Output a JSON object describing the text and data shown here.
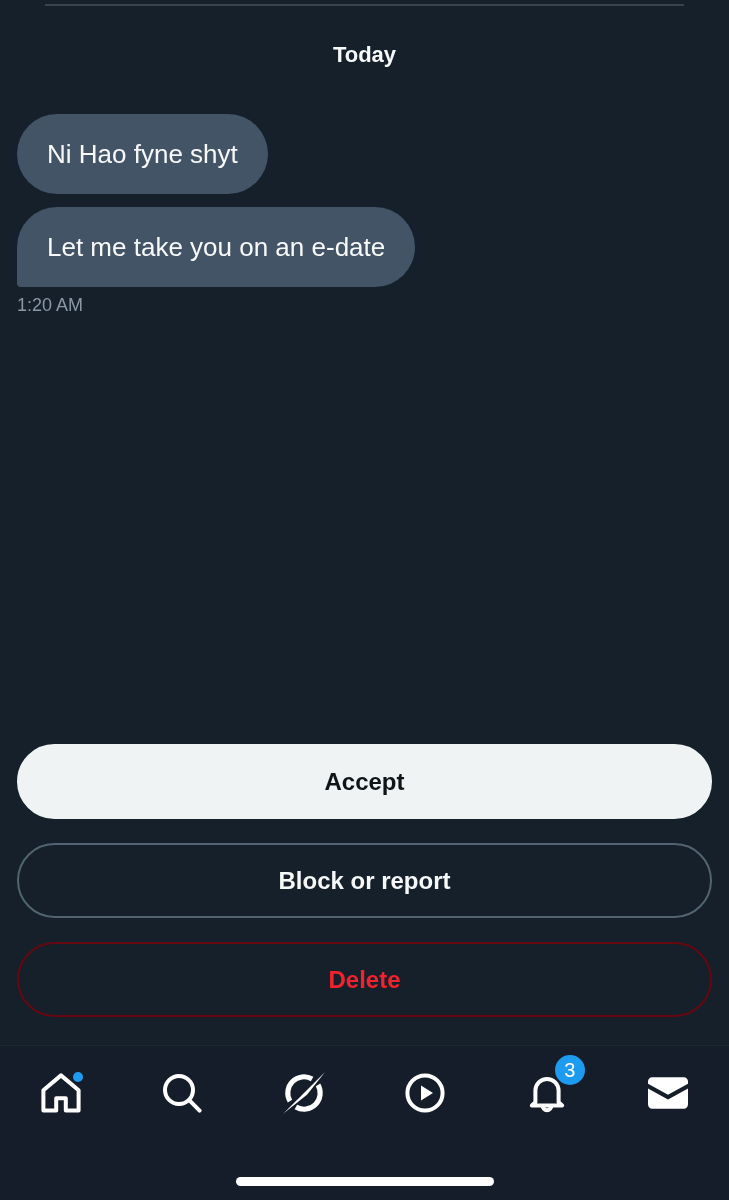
{
  "date_header": "Today",
  "messages": [
    {
      "text": "Ni Hao fyne shyt",
      "tail": false
    },
    {
      "text": "Let me take you on an e-date",
      "tail": true
    }
  ],
  "timestamp": "1:20 AM",
  "actions": [
    {
      "label": "Accept",
      "kind": "primary"
    },
    {
      "label": "Block or report",
      "kind": "outline"
    },
    {
      "label": "Delete",
      "kind": "danger"
    }
  ],
  "nav": [
    {
      "kind": "home",
      "selected": false,
      "dot": true
    },
    {
      "kind": "search",
      "selected": false,
      "dot": false
    },
    {
      "kind": "slash",
      "selected": false,
      "dot": false
    },
    {
      "kind": "play",
      "selected": false,
      "dot": false
    },
    {
      "kind": "bell",
      "selected": false,
      "dot": false,
      "badge": "3"
    },
    {
      "kind": "mail",
      "selected": true,
      "dot": false
    }
  ]
}
